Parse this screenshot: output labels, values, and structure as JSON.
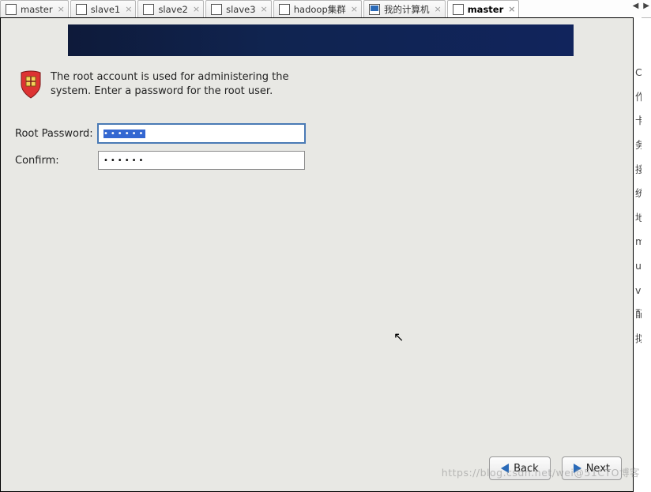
{
  "tabs": [
    {
      "label": "master",
      "active": false,
      "iconType": "box"
    },
    {
      "label": "slave1",
      "active": false,
      "iconType": "box"
    },
    {
      "label": "slave2",
      "active": false,
      "iconType": "box"
    },
    {
      "label": "slave3",
      "active": false,
      "iconType": "box"
    },
    {
      "label": "hadoop集群",
      "active": false,
      "iconType": "box"
    },
    {
      "label": "我的计算机",
      "active": false,
      "iconType": "screen"
    },
    {
      "label": "master",
      "active": true,
      "iconType": "box"
    }
  ],
  "installer": {
    "description": "The root account is used for administering the system.  Enter a password for the root user.",
    "fields": {
      "root_password_label": "Root Password:",
      "root_password_value": "••••••",
      "confirm_label": "Confirm:",
      "confirm_value": "••••••"
    },
    "buttons": {
      "back": "Back",
      "next": "Next"
    }
  },
  "side_items": [
    "Ce",
    "作系",
    "卡，",
    "务也",
    "接成",
    "统映",
    "地y",
    "m源",
    "um",
    "va环",
    "配置",
    "拟"
  ],
  "watermark": "https://blog.csdn.net/wei@51CTO博客"
}
